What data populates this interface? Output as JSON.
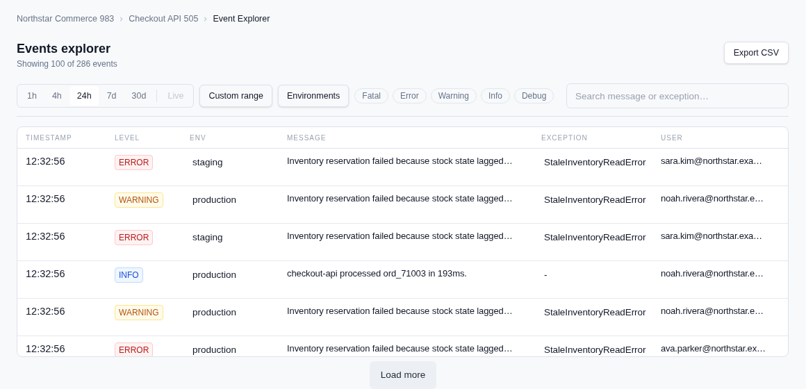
{
  "breadcrumb": [
    {
      "label": "Northstar Commerce 983",
      "current": false
    },
    {
      "label": "Checkout API 505",
      "current": false
    },
    {
      "label": "Event Explorer",
      "current": true
    }
  ],
  "header": {
    "title": "Events explorer",
    "subtitle": "Showing 100 of 286 events",
    "export_button": "Export CSV"
  },
  "time_ranges": [
    {
      "label": "1h",
      "selected": false,
      "disabled": false
    },
    {
      "label": "4h",
      "selected": false,
      "disabled": false
    },
    {
      "label": "24h",
      "selected": true,
      "disabled": false
    },
    {
      "label": "7d",
      "selected": false,
      "disabled": false
    },
    {
      "label": "30d",
      "selected": false,
      "disabled": false
    },
    {
      "label": "Live",
      "selected": false,
      "disabled": true
    }
  ],
  "filter_buttons": [
    "Custom range",
    "Environments"
  ],
  "level_filters": [
    {
      "label": "Fatal",
      "selected": false
    },
    {
      "label": "Error",
      "selected": false
    },
    {
      "label": "Warning",
      "selected": false
    },
    {
      "label": "Info",
      "selected": false
    },
    {
      "label": "Debug",
      "selected": false
    }
  ],
  "search": {
    "placeholder": "Search message or exception…"
  },
  "table": {
    "columns": [
      "TIMESTAMP",
      "LEVEL",
      "ENV",
      "MESSAGE",
      "EXCEPTION",
      "USER"
    ],
    "rows": [
      {
        "timestamp": "12:32:56",
        "level": "ERROR",
        "env": "staging",
        "message": "Inventory reservation failed because stock state lagged…",
        "exception": "StaleInventoryReadError",
        "user": "sara.kim@northstar.exa…"
      },
      {
        "timestamp": "12:32:56",
        "level": "WARNING",
        "env": "production",
        "message": "Inventory reservation failed because stock state lagged…",
        "exception": "StaleInventoryReadError",
        "user": "noah.rivera@northstar.e…"
      },
      {
        "timestamp": "12:32:56",
        "level": "ERROR",
        "env": "staging",
        "message": "Inventory reservation failed because stock state lagged…",
        "exception": "StaleInventoryReadError",
        "user": "sara.kim@northstar.exa…"
      },
      {
        "timestamp": "12:32:56",
        "level": "INFO",
        "env": "production",
        "message": "checkout-api processed ord_71003 in 193ms.",
        "exception": "-",
        "user": "noah.rivera@northstar.e…"
      },
      {
        "timestamp": "12:32:56",
        "level": "WARNING",
        "env": "production",
        "message": "Inventory reservation failed because stock state lagged…",
        "exception": "StaleInventoryReadError",
        "user": "noah.rivera@northstar.e…"
      },
      {
        "timestamp": "12:32:56",
        "level": "ERROR",
        "env": "production",
        "message": "Inventory reservation failed because stock state lagged…",
        "exception": "StaleInventoryReadError",
        "user": "ava.parker@northstar.ex…"
      }
    ]
  },
  "load_more": "Load more"
}
